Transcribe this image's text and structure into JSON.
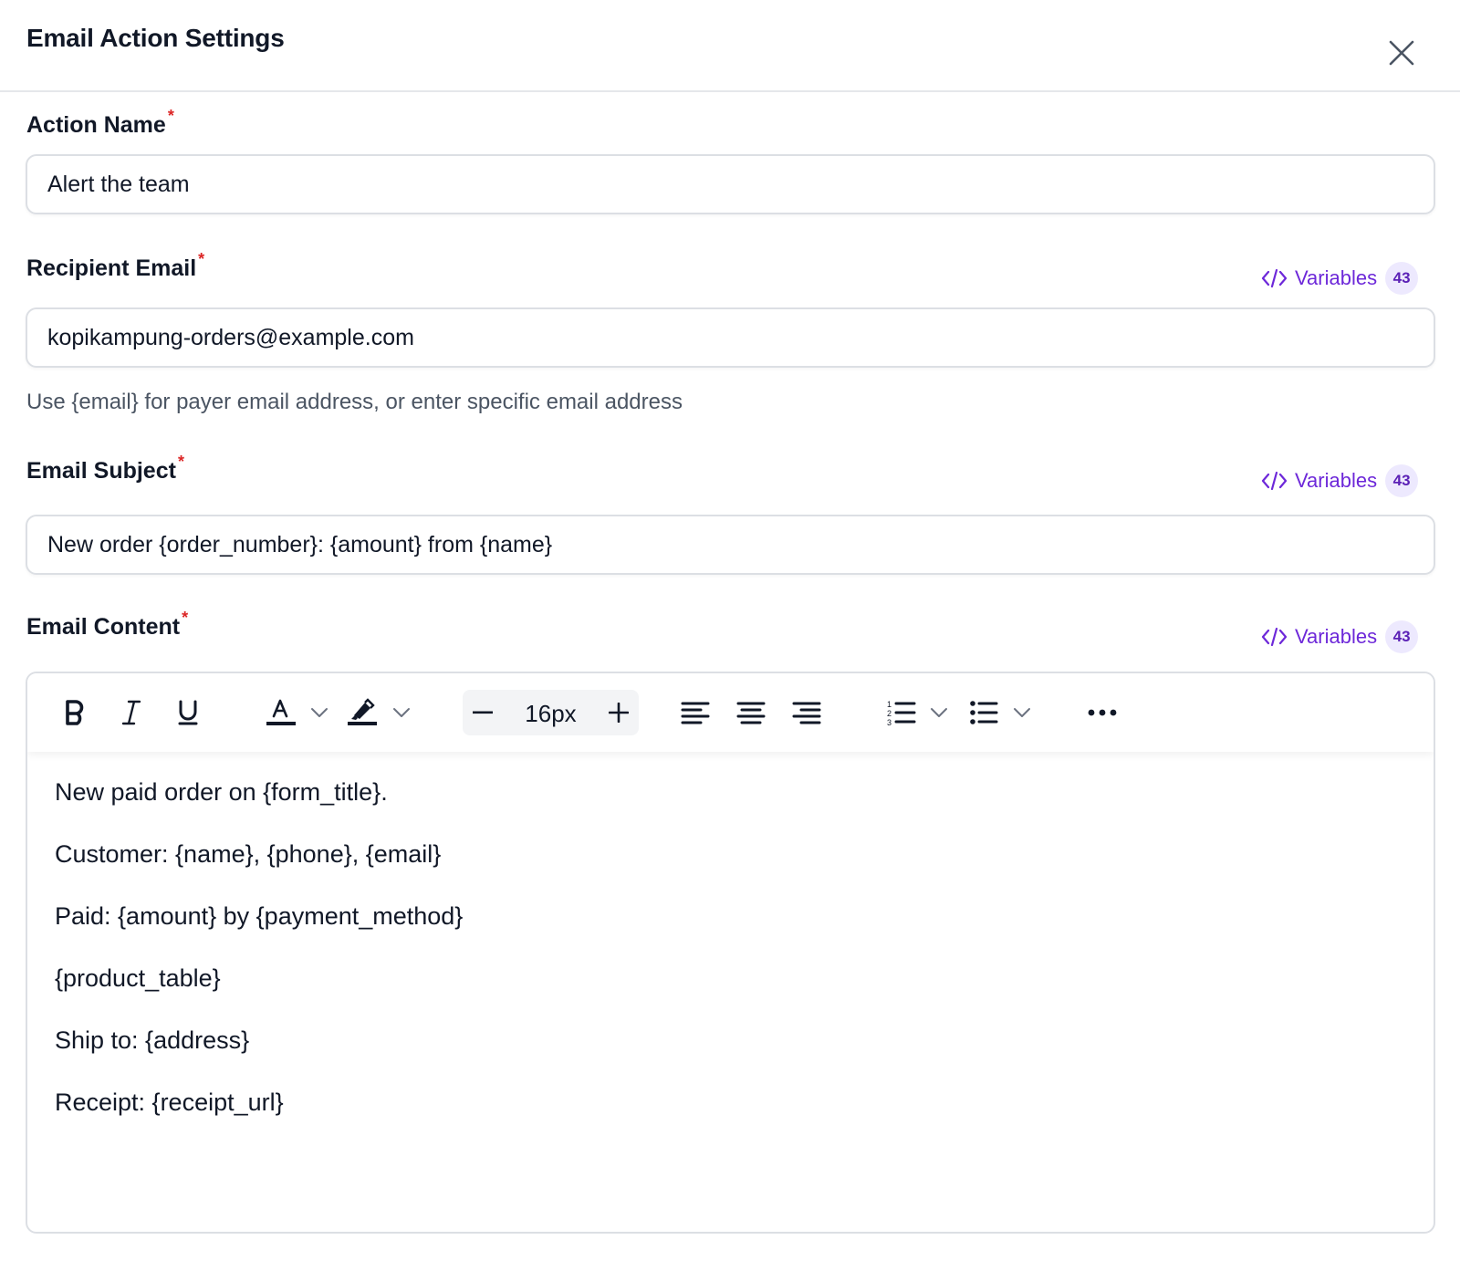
{
  "dialog": {
    "title": "Email Action Settings"
  },
  "action_name": {
    "label": "Action Name",
    "required_mark": "*",
    "value": "Alert the team"
  },
  "recipient_email": {
    "label": "Recipient Email",
    "required_mark": "*",
    "value": "kopikampung-orders@example.com",
    "help_text": "Use {email} for payer email address, or enter specific email address",
    "variables_label": "Variables",
    "variables_count": "43"
  },
  "email_subject": {
    "label": "Email Subject",
    "required_mark": "*",
    "value": "New order {order_number}: {amount} from {name}",
    "variables_label": "Variables",
    "variables_count": "43"
  },
  "email_content": {
    "label": "Email Content",
    "required_mark": "*",
    "variables_label": "Variables",
    "variables_count": "43",
    "toolbar": {
      "font_size": "16px"
    },
    "lines": [
      "New paid order on {form_title}.",
      "Customer: {name}, {phone}, {email}",
      "Paid: {amount} by {payment_method}",
      "{product_table}",
      "Ship to: {address}",
      "Receipt: {receipt_url}"
    ]
  },
  "colors": {
    "accent": "#6d28d9",
    "required": "#dc2626",
    "badge_bg": "#ede9fe"
  }
}
